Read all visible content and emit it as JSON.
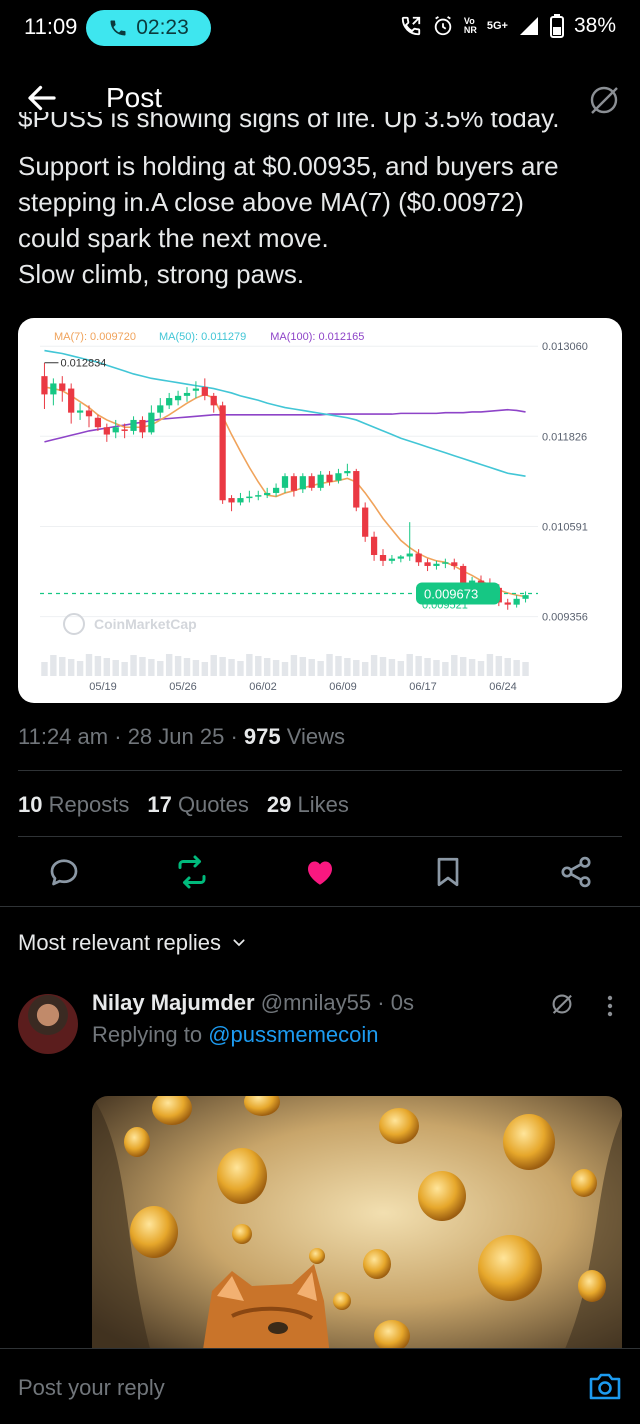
{
  "status_bar": {
    "time": "11:09",
    "call_timer": "02:23",
    "network_top": "Vo",
    "network_bottom": "NR",
    "network_5g": "5G+",
    "battery": "38%",
    "accent": "#3ee6ef"
  },
  "header": {
    "title": "Post",
    "back_icon": "back-arrow-icon",
    "grok_icon": "grok-icon"
  },
  "post": {
    "cut_text": "$PUSS is showing signs of life. Up 3.5% today.",
    "lines": [
      "Support is holding at $0.00935, and buyers are",
      "stepping in.A close above MA(7) ($0.00972)",
      "could spark the next move.",
      "Slow climb, strong paws."
    ],
    "time": "11:24 am",
    "date": "28 Jun 25",
    "views_count": "975",
    "views_label": "Views"
  },
  "chart_data": {
    "type": "candlestick",
    "legend": [
      {
        "name": "MA(7): 0.009720",
        "color": "#f0a35b"
      },
      {
        "name": "MA(50): 0.011279",
        "color": "#42c6d6"
      },
      {
        "name": "MA(100): 0.012165",
        "color": "#8e44c8"
      }
    ],
    "y_ticks": [
      "0.013060",
      "0.011826",
      "0.010591",
      "0.009356"
    ],
    "x_ticks": [
      "05/19",
      "05/26",
      "06/02",
      "06/09",
      "06/17",
      "06/24"
    ],
    "high_label": "0.012834",
    "current_price": "0.009673",
    "low_label": "0.009521",
    "watermark": "CoinMarketCap",
    "candles": [
      [
        0.01265,
        0.0124,
        0.01283,
        0.0122
      ],
      [
        0.0124,
        0.01255,
        0.01262,
        0.01225
      ],
      [
        0.01255,
        0.01245,
        0.01265,
        0.0123
      ],
      [
        0.01248,
        0.01215,
        0.01255,
        0.012
      ],
      [
        0.01215,
        0.01218,
        0.01228,
        0.01205
      ],
      [
        0.01218,
        0.0121,
        0.01225,
        0.01195
      ],
      [
        0.01208,
        0.01195,
        0.01212,
        0.0119
      ],
      [
        0.01195,
        0.01185,
        0.012,
        0.01175
      ],
      [
        0.01188,
        0.01195,
        0.01205,
        0.0118
      ],
      [
        0.01192,
        0.0119,
        0.012,
        0.0118
      ],
      [
        0.0119,
        0.01205,
        0.0121,
        0.01185
      ],
      [
        0.01205,
        0.01188,
        0.0121,
        0.0118
      ],
      [
        0.01188,
        0.01215,
        0.01225,
        0.01185
      ],
      [
        0.01215,
        0.01225,
        0.01235,
        0.01208
      ],
      [
        0.01225,
        0.01235,
        0.01242,
        0.0122
      ],
      [
        0.01232,
        0.01238,
        0.01245,
        0.01225
      ],
      [
        0.01238,
        0.01242,
        0.0125,
        0.0123
      ],
      [
        0.01245,
        0.01248,
        0.01258,
        0.01235
      ],
      [
        0.0125,
        0.01238,
        0.01262,
        0.01232
      ],
      [
        0.01238,
        0.01225,
        0.01242,
        0.01215
      ],
      [
        0.01225,
        0.01095,
        0.0123,
        0.0109
      ],
      [
        0.01098,
        0.01092,
        0.01102,
        0.0108
      ],
      [
        0.01092,
        0.01098,
        0.01105,
        0.01088
      ],
      [
        0.01098,
        0.011,
        0.01108,
        0.01092
      ],
      [
        0.011,
        0.01102,
        0.01108,
        0.01095
      ],
      [
        0.01102,
        0.01105,
        0.01112,
        0.01098
      ],
      [
        0.01105,
        0.01112,
        0.01118,
        0.011
      ],
      [
        0.01112,
        0.01128,
        0.01132,
        0.01105
      ],
      [
        0.01128,
        0.01108,
        0.01132,
        0.011
      ],
      [
        0.0111,
        0.01128,
        0.01132,
        0.01105
      ],
      [
        0.01128,
        0.01112,
        0.01132,
        0.01108
      ],
      [
        0.01112,
        0.0113,
        0.01135,
        0.01108
      ],
      [
        0.0113,
        0.0112,
        0.01135,
        0.01115
      ],
      [
        0.01122,
        0.01132,
        0.01138,
        0.01118
      ],
      [
        0.01132,
        0.01135,
        0.01145,
        0.01128
      ],
      [
        0.01135,
        0.01085,
        0.01138,
        0.0108
      ],
      [
        0.01085,
        0.01045,
        0.01092,
        0.01038
      ],
      [
        0.01045,
        0.0102,
        0.01052,
        0.01012
      ],
      [
        0.0102,
        0.01012,
        0.01028,
        0.01005
      ],
      [
        0.01012,
        0.01015,
        0.0102,
        0.01008
      ],
      [
        0.01015,
        0.01018,
        0.0102,
        0.0101
      ],
      [
        0.01018,
        0.01022,
        0.01065,
        0.01012
      ],
      [
        0.01022,
        0.0101,
        0.01028,
        0.01005
      ],
      [
        0.0101,
        0.01005,
        0.01015,
        0.00998
      ],
      [
        0.01005,
        0.01008,
        0.01012,
        0.01
      ],
      [
        0.01008,
        0.0101,
        0.01015,
        0.01002
      ],
      [
        0.0101,
        0.01005,
        0.01015,
        0.01
      ],
      [
        0.01005,
        0.0096,
        0.01008,
        0.00955
      ],
      [
        0.0096,
        0.00985,
        0.0099,
        0.00955
      ],
      [
        0.00985,
        0.00978,
        0.00992,
        0.00975
      ],
      [
        0.00978,
        0.00975,
        0.00988,
        0.0097
      ],
      [
        0.00975,
        0.00955,
        0.0098,
        0.0095
      ],
      [
        0.00955,
        0.00952,
        0.0096,
        0.00945
      ],
      [
        0.00952,
        0.0096,
        0.00965,
        0.00948
      ],
      [
        0.0096,
        0.00965,
        0.0097,
        0.00955
      ]
    ],
    "ma7": [
      0.0125,
      0.01248,
      0.01245,
      0.01238,
      0.0123,
      0.01222,
      0.01212,
      0.01205,
      0.012,
      0.01195,
      0.01195,
      0.01195,
      0.01198,
      0.01205,
      0.01212,
      0.0122,
      0.01228,
      0.01235,
      0.0124,
      0.01235,
      0.0121,
      0.01185,
      0.01162,
      0.0114,
      0.0112,
      0.01102,
      0.011,
      0.01105,
      0.01108,
      0.01112,
      0.01115,
      0.01118,
      0.0112,
      0.01122,
      0.01125,
      0.0112,
      0.01105,
      0.01088,
      0.0107,
      0.01055,
      0.0104,
      0.0103,
      0.01022,
      0.01016,
      0.01012,
      0.0101,
      0.01005,
      0.00998,
      0.00992,
      0.00985,
      0.00978,
      0.00972,
      0.00968,
      0.00965,
      0.00963
    ],
    "ma50": [
      0.013,
      0.01298,
      0.01296,
      0.01293,
      0.0129,
      0.01287,
      0.01284,
      0.0128,
      0.01276,
      0.01272,
      0.01268,
      0.01265,
      0.01262,
      0.0126,
      0.01258,
      0.01256,
      0.01254,
      0.01252,
      0.0125,
      0.01248,
      0.01245,
      0.01242,
      0.01238,
      0.01235,
      0.01232,
      0.01228,
      0.01225,
      0.01222,
      0.0122,
      0.01218,
      0.01216,
      0.01214,
      0.01212,
      0.0121,
      0.01208,
      0.01205,
      0.012,
      0.01195,
      0.0119,
      0.01185,
      0.0118,
      0.01176,
      0.01172,
      0.01168,
      0.01164,
      0.0116,
      0.01156,
      0.01152,
      0.01148,
      0.01144,
      0.0114,
      0.01136,
      0.01132,
      0.0113,
      0.01128
    ],
    "ma100": [
      0.01175,
      0.01178,
      0.01181,
      0.01184,
      0.01187,
      0.0119,
      0.01192,
      0.01194,
      0.01196,
      0.01198,
      0.012,
      0.01202,
      0.01204,
      0.01206,
      0.01207,
      0.01208,
      0.01209,
      0.0121,
      0.01211,
      0.01212,
      0.01212,
      0.01212,
      0.01212,
      0.01212,
      0.01212,
      0.01212,
      0.01212,
      0.01212,
      0.01212,
      0.01212,
      0.01212,
      0.01212,
      0.01213,
      0.01213,
      0.01213,
      0.01213,
      0.01213,
      0.01213,
      0.01213,
      0.01213,
      0.01214,
      0.01214,
      0.01214,
      0.01214,
      0.01214,
      0.01215,
      0.01215,
      0.01215,
      0.01216,
      0.01216,
      0.01217,
      0.01218,
      0.01219,
      0.01218,
      0.01216
    ],
    "ylim": [
      0.0092,
      0.0132
    ]
  },
  "engagement": {
    "reposts_count": "10",
    "reposts_label": "Reposts",
    "quotes_count": "17",
    "quotes_label": "Quotes",
    "likes_count": "29",
    "likes_label": "Likes",
    "like_color": "#f91880",
    "repost_color": "#00ba7c"
  },
  "replies": {
    "heading": "Most relevant replies",
    "items": [
      {
        "name": "Nilay Majumder",
        "handle": "@mnilay55",
        "time": "0s",
        "replying_label": "Replying to",
        "replying_to": "@pussmemecoin"
      }
    ]
  },
  "composer": {
    "placeholder": "Post your reply"
  }
}
